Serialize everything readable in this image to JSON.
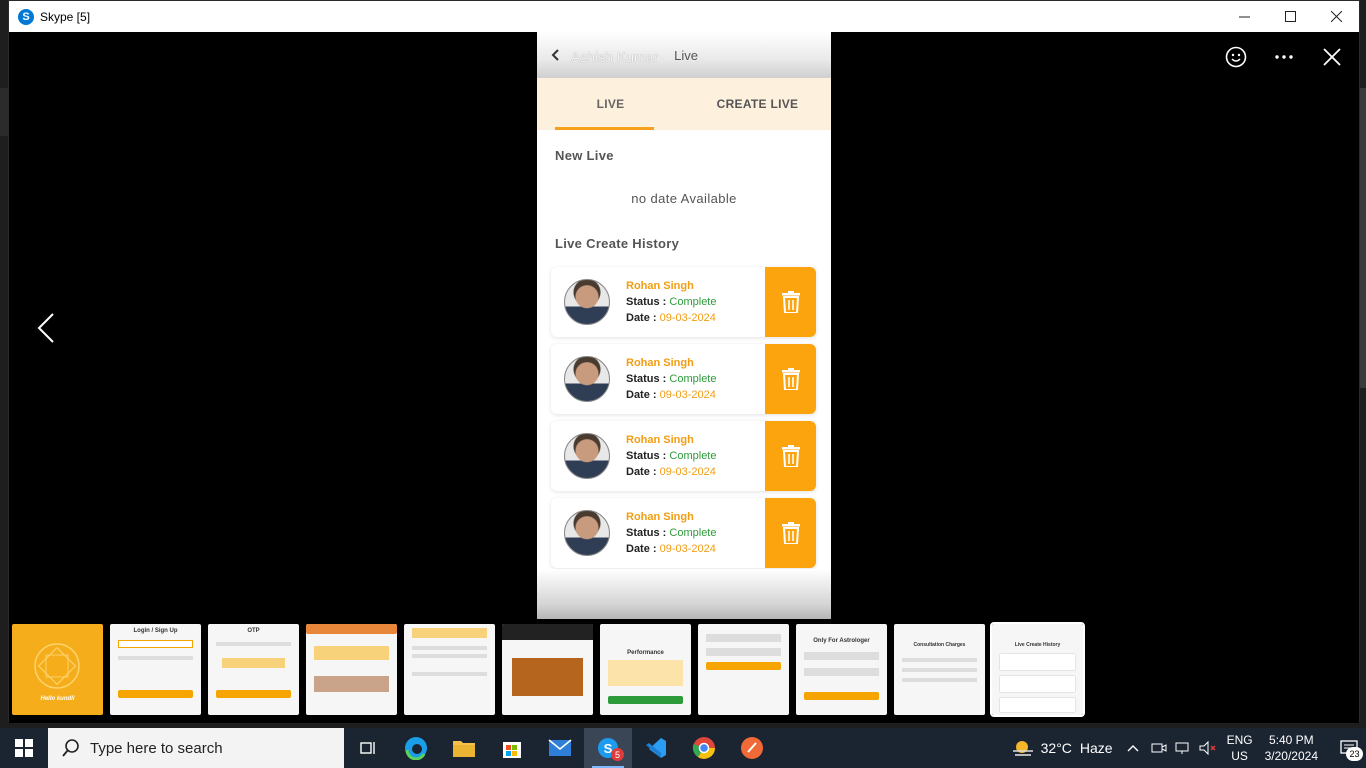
{
  "window": {
    "title": "Skype [5]",
    "minimize_label": "—",
    "maximize_label": "☐",
    "close_label": "✕"
  },
  "phone": {
    "header": {
      "name": "Ashish Kumar",
      "subtitle": "Live"
    },
    "tabs": [
      {
        "label": "LIVE",
        "active": true
      },
      {
        "label": "CREATE LIVE",
        "active": false
      }
    ],
    "new_live_title": "New Live",
    "empty_text": "no date Available",
    "history_title": "Live Create History",
    "history": [
      {
        "name": "Rohan Singh",
        "status_label": "Status :",
        "status": "Complete",
        "date_label": "Date :",
        "date": "09-03-2024"
      },
      {
        "name": "Rohan Singh",
        "status_label": "Status :",
        "status": "Complete",
        "date_label": "Date :",
        "date": "09-03-2024"
      },
      {
        "name": "Rohan Singh",
        "status_label": "Status :",
        "status": "Complete",
        "date_label": "Date :",
        "date": "09-03-2024"
      },
      {
        "name": "Rohan Singh",
        "status_label": "Status :",
        "status": "Complete",
        "date_label": "Date :",
        "date": "09-03-2024"
      }
    ]
  },
  "thumbnails": [
    {
      "title": "Hello kundli",
      "selected": false
    },
    {
      "title": "Login / Sign Up",
      "selected": false
    },
    {
      "title": "OTP",
      "selected": false
    },
    {
      "title": "",
      "selected": false
    },
    {
      "title": "",
      "selected": false
    },
    {
      "title": "",
      "selected": false
    },
    {
      "title": "Performance",
      "selected": false
    },
    {
      "title": "",
      "selected": false
    },
    {
      "title": "Only For Astrologer",
      "selected": false
    },
    {
      "title": "Consultation Charges",
      "selected": false
    },
    {
      "title": "Live Create History",
      "selected": true
    }
  ],
  "taskbar": {
    "search_placeholder": "Type here to search",
    "weather": {
      "temp": "32°C",
      "desc": "Haze"
    },
    "lang": {
      "line1": "ENG",
      "line2": "US"
    },
    "time": "5:40 PM",
    "date": "3/20/2024",
    "notifications": "23",
    "skype_badge": "5"
  },
  "colors": {
    "accent": "#f7a11a",
    "status_green": "#2e9b3b",
    "tab_bg": "#fdf0dc"
  }
}
